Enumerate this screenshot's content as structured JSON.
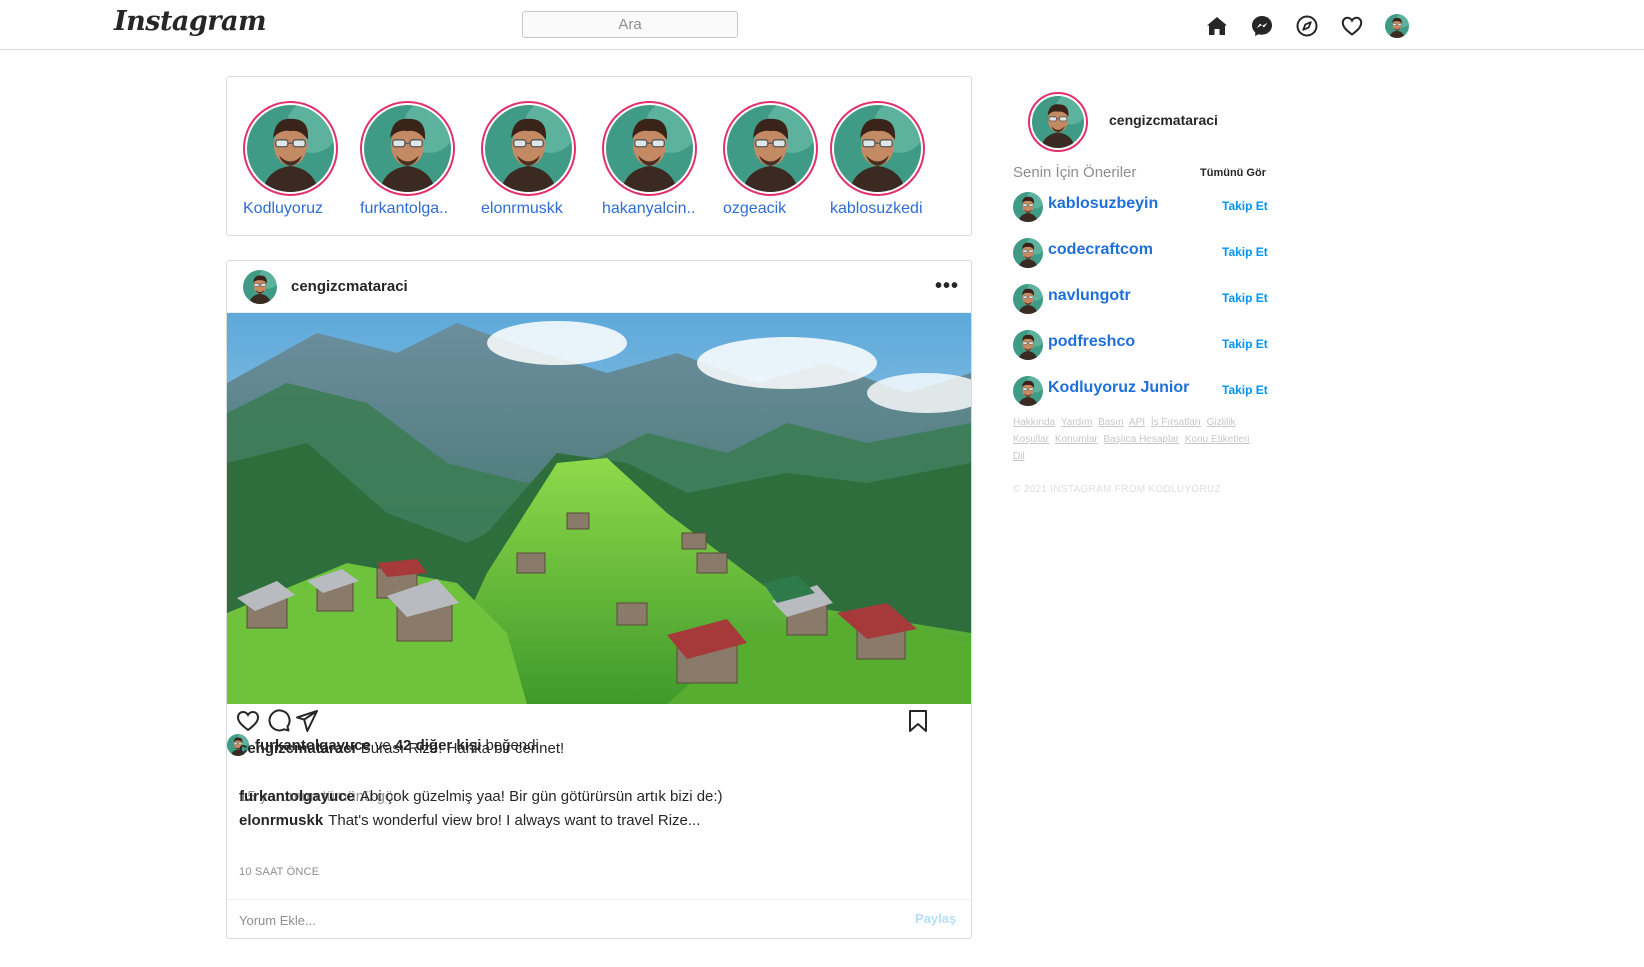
{
  "header": {
    "logo": "Instagram",
    "search_placeholder": "Ara",
    "icons": [
      "home-icon",
      "messenger-icon",
      "explore-icon",
      "heart-icon",
      "profile-avatar"
    ]
  },
  "stories": [
    {
      "name": "Kodluyoruz"
    },
    {
      "name": "furkantolga.."
    },
    {
      "name": "elonrmuskk"
    },
    {
      "name": "hakanyalcin.."
    },
    {
      "name": "ozgeacik"
    },
    {
      "name": "kablosuzkedi"
    }
  ],
  "post": {
    "username": "cengizcmataraci",
    "more": "•••",
    "likes": {
      "liker": "furkantolgayuce",
      "connector": "ve",
      "others": "42 diğer kişi",
      "suffix": "beğendi"
    },
    "caption": {
      "user": "cengizcmataraci",
      "text": "Burası Rize! Harika bir cennet!"
    },
    "view_all_comments": "15 yorumun tümünü gör",
    "comments": [
      {
        "user": "furkantolgayuce",
        "text": "Abi çok güzelmiş yaa! Bir gün götürürsün artık bizi de:)"
      },
      {
        "user": "elonrmuskk",
        "text": "That's wonderful view bro! I always want to travel Rize..."
      }
    ],
    "time": "10 SAAT ÖNCE",
    "comment_placeholder": "Yorum Ekle...",
    "share_label": "Paylaş"
  },
  "sidebar": {
    "me": "cengizcmataraci",
    "suggestions_title": "Senin İçin Öneriler",
    "see_all": "Tümünü Gör",
    "suggestions": [
      {
        "name": "kablosuzbeyin",
        "follow": "Takip Et"
      },
      {
        "name": "codecraftcom",
        "follow": "Takip Et"
      },
      {
        "name": "navlungotr",
        "follow": "Takip Et"
      },
      {
        "name": "podfreshco",
        "follow": "Takip Et"
      },
      {
        "name": "Kodluyoruz Junior",
        "follow": "Takip Et"
      }
    ],
    "footer_links": [
      "Hakkında",
      "Yardım",
      "Basın",
      "API",
      "İş Fırsatları",
      "Gizlilik",
      "Koşullar",
      "Konumlar",
      "Başlıca Hesaplar",
      "Konu Etiketleri",
      "Dil"
    ],
    "copyright": "© 2021 INSTAGRAM FROM KODLUYORUZ"
  },
  "colors": {
    "story_ring": "#e1306c",
    "link_blue": "#1f6fdb",
    "follow_blue": "#0095f6",
    "border": "#dbdbdb"
  }
}
